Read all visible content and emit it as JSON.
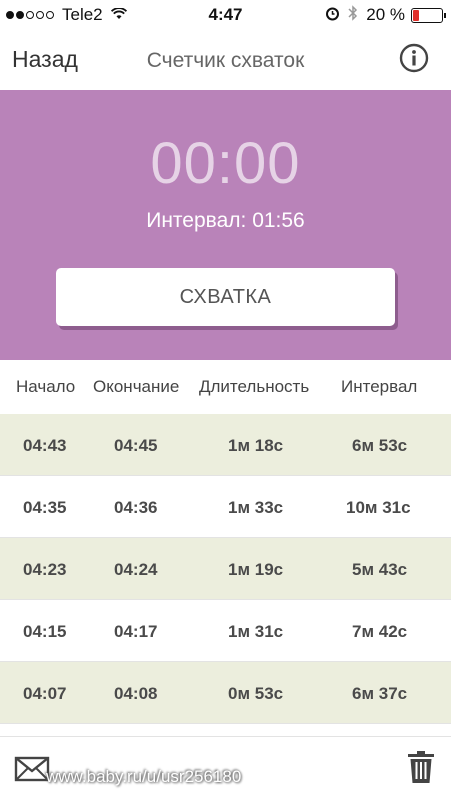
{
  "status_bar": {
    "carrier": "Tele2",
    "time": "4:47",
    "battery": "20 %",
    "icons": [
      "signal-dots",
      "wifi-icon",
      "alarm-icon",
      "bluetooth-icon",
      "battery-icon"
    ]
  },
  "nav": {
    "back_label": "Назад",
    "title": "Счетчик схваток",
    "info_icon": "info-icon"
  },
  "timer": {
    "display": "00:00",
    "interval_text": "Интервал: 01:56",
    "button_label": "СХВАТКА"
  },
  "table": {
    "headers": [
      "Начало",
      "Окончание",
      "Длительность",
      "Интервал"
    ],
    "rows": [
      {
        "start": "04:43",
        "end": "04:45",
        "duration": "1м 18с",
        "interval": "6м 53с"
      },
      {
        "start": "04:35",
        "end": "04:36",
        "duration": "1м 33с",
        "interval": "10м 31с"
      },
      {
        "start": "04:23",
        "end": "04:24",
        "duration": "1м 19с",
        "interval": "5м 43с"
      },
      {
        "start": "04:15",
        "end": "04:17",
        "duration": "1м 31с",
        "interval": "7м 42с"
      },
      {
        "start": "04:07",
        "end": "04:08",
        "duration": "0м 53с",
        "interval": "6м 37с"
      }
    ]
  },
  "bottom_bar": {
    "watermark": "www.baby.ru/u/usr256180",
    "mail_icon": "mail-icon",
    "trash_icon": "trash-icon"
  },
  "colors": {
    "hero_background": "#b983b9",
    "timer_text": "#e6d3e6",
    "row_highlight": "#eceedd"
  }
}
